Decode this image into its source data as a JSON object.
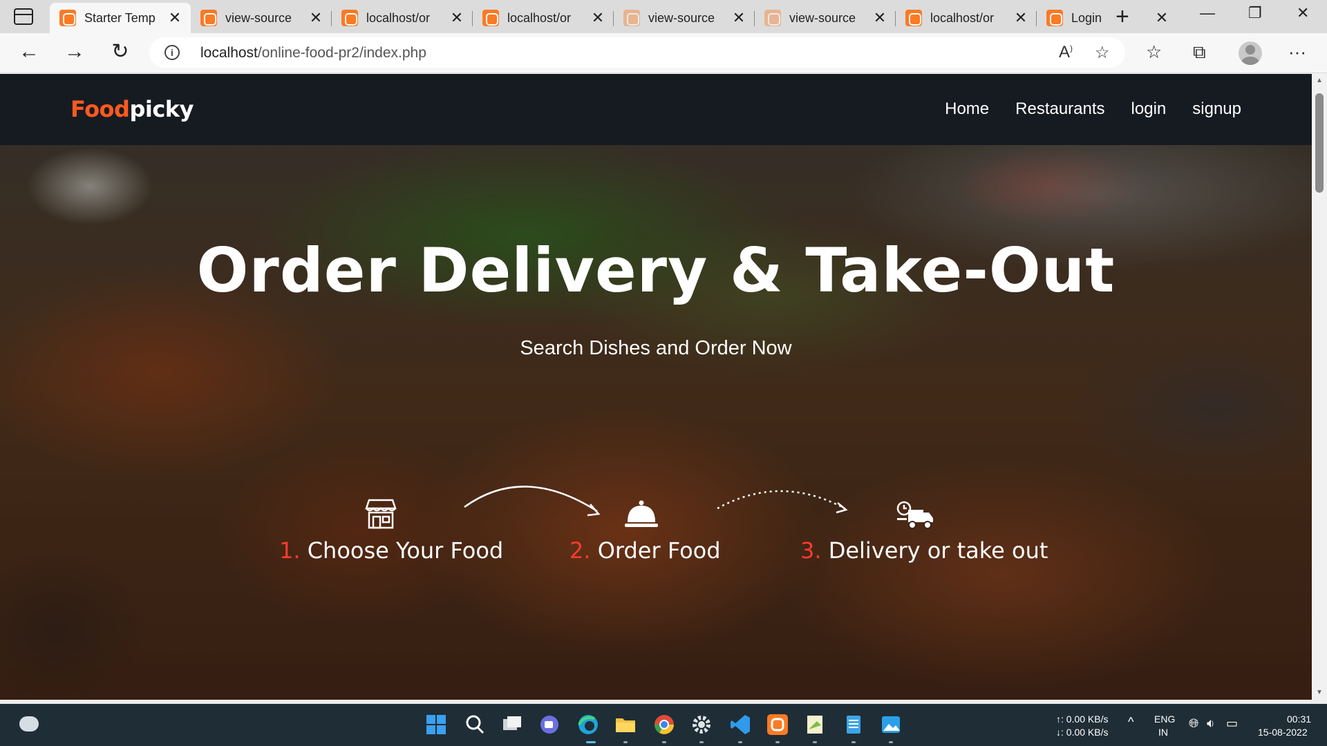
{
  "browser": {
    "tabs": [
      {
        "title": "Starter Temp",
        "active": true,
        "faded": false
      },
      {
        "title": "view-source",
        "active": false,
        "faded": false
      },
      {
        "title": "localhost/or",
        "active": false,
        "faded": false
      },
      {
        "title": "localhost/or",
        "active": false,
        "faded": false
      },
      {
        "title": "view-source",
        "active": false,
        "faded": true
      },
      {
        "title": "view-source",
        "active": false,
        "faded": true
      },
      {
        "title": "localhost/or",
        "active": false,
        "faded": false
      },
      {
        "title": "Login",
        "active": false,
        "faded": false
      }
    ],
    "address": {
      "host": "localhost",
      "path": "/online-food-pr2/index.php"
    }
  },
  "site": {
    "logo": {
      "part1": "Food",
      "part2": "picky"
    },
    "menu": [
      "Home",
      "Restaurants",
      "login",
      "signup"
    ],
    "hero": {
      "title": "Order Delivery & Take-Out",
      "subtitle": "Search Dishes and Order Now"
    },
    "steps": [
      {
        "num": "1.",
        "label": "Choose Your Food",
        "icon": "store-icon"
      },
      {
        "num": "2.",
        "label": "Order Food",
        "icon": "cloche-icon"
      },
      {
        "num": "3.",
        "label": "Delivery or take out",
        "icon": "delivery-truck-icon"
      }
    ]
  },
  "taskbar": {
    "network_up": "↑: 0.00 KB/s",
    "network_down": "↓: 0.00 KB/s",
    "lang_line1": "ENG",
    "lang_line2": "IN",
    "time": "00:31",
    "date": "15-08-2022"
  },
  "colors": {
    "accent_orange": "#ff5a1f",
    "step_number_red": "#ff3b2f",
    "site_nav_bg": "#161b22",
    "taskbar_bg": "#1f2d36"
  }
}
